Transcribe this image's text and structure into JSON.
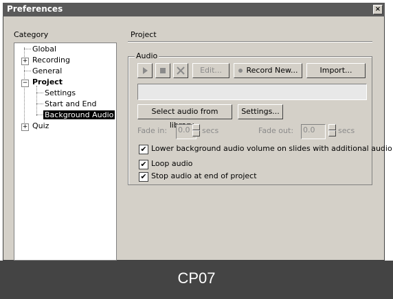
{
  "window": {
    "title": "Preferences",
    "close_glyph": "×"
  },
  "category_label": "Category",
  "section_label": "Project",
  "tree": {
    "global": "Global",
    "recording": "Recording",
    "general": "General",
    "project": "Project",
    "settings": "Settings",
    "start_end": "Start and End",
    "background_audio": "Background Audio",
    "quiz": "Quiz"
  },
  "audio": {
    "group_label": "Audio",
    "edit_label": "Edit...",
    "record_new_label": "Record New...",
    "import_label": "Import...",
    "select_library_label": "Select audio from library...",
    "settings_label": "Settings...",
    "fade_in_label": "Fade in:",
    "fade_in_value": "0.0",
    "fade_in_unit": "secs",
    "fade_out_label": "Fade out:",
    "fade_out_value": "0.0",
    "fade_out_unit": "secs",
    "lower_volume_label": "Lower background audio volume on slides with additional audio",
    "loop_label": "Loop audio",
    "stop_label": "Stop audio at end of project"
  },
  "caption": "CP07"
}
